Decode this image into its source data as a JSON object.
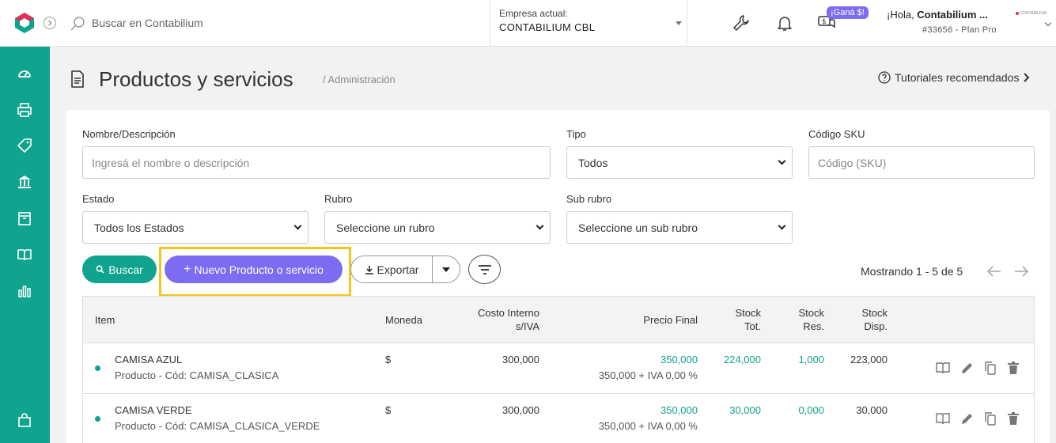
{
  "topbar": {
    "search_placeholder": "Buscar en Contabilium",
    "company_label": "Empresa actual:",
    "company_value": "CONTABILIUM CBL",
    "badge": "¡Ganá $!",
    "greeting_prefix": "¡Hola, ",
    "greeting_name": "Contabilium ...",
    "plan": "#33656 - Plan Pro",
    "mini_logo": "CONTABILIUM"
  },
  "sidebar": {
    "items": [
      "dashboard-icon",
      "printer-icon",
      "tag-icon",
      "bank-icon",
      "box-icon",
      "book-icon",
      "bar-chart-icon",
      "shopping-bag-icon"
    ]
  },
  "header": {
    "title": "Productos y servicios",
    "breadcrumb": "/ Administración",
    "tutorials": "Tutoriales recomendados"
  },
  "filters": {
    "name_label": "Nombre/Descripción",
    "name_placeholder": "Ingresá el nombre o descripción",
    "tipo_label": "Tipo",
    "tipo_value": "Todos",
    "sku_label": "Código SKU",
    "sku_placeholder": "Código (SKU)",
    "estado_label": "Estado",
    "estado_value": "Todos los Estados",
    "rubro_label": "Rubro",
    "rubro_value": "Seleccione un rubro",
    "subrubro_label": "Sub rubro",
    "subrubro_value": "Seleccione un sub rubro"
  },
  "actions": {
    "buscar": "Buscar",
    "nuevo": "Nuevo Producto o servicio",
    "exportar": "Exportar",
    "showing": "Mostrando 1 - 5 de 5"
  },
  "table": {
    "headers": {
      "item": "Item",
      "moneda": "Moneda",
      "costo1": "Costo Interno",
      "costo2": "s/IVA",
      "precio": "Precio Final",
      "stot1": "Stock",
      "stot2": "Tot.",
      "sres1": "Stock",
      "sres2": "Res.",
      "sdisp1": "Stock",
      "sdisp2": "Disp."
    },
    "rows": [
      {
        "name": "CAMISA AZUL",
        "detail": "Producto - Cód: CAMISA_CLASICA",
        "moneda": "$",
        "costo": "300,000",
        "precio": "350,000",
        "precio_detail": "350,000 + IVA 0,00 %",
        "stock_tot": "224,000",
        "stock_res": "1,000",
        "stock_disp": "223,000"
      },
      {
        "name": "CAMISA VERDE",
        "detail": "Producto - Cód: CAMISA_CLASICA_VERDE",
        "moneda": "$",
        "costo": "300,000",
        "precio": "350,000",
        "precio_detail": "350,000 + IVA 0,00 %",
        "stock_tot": "30,000",
        "stock_res": "0,000",
        "stock_disp": "30,000"
      }
    ]
  },
  "colors": {
    "accent": "#10a38d",
    "primary": "#7c6cf2",
    "highlight": "#f5c518"
  }
}
